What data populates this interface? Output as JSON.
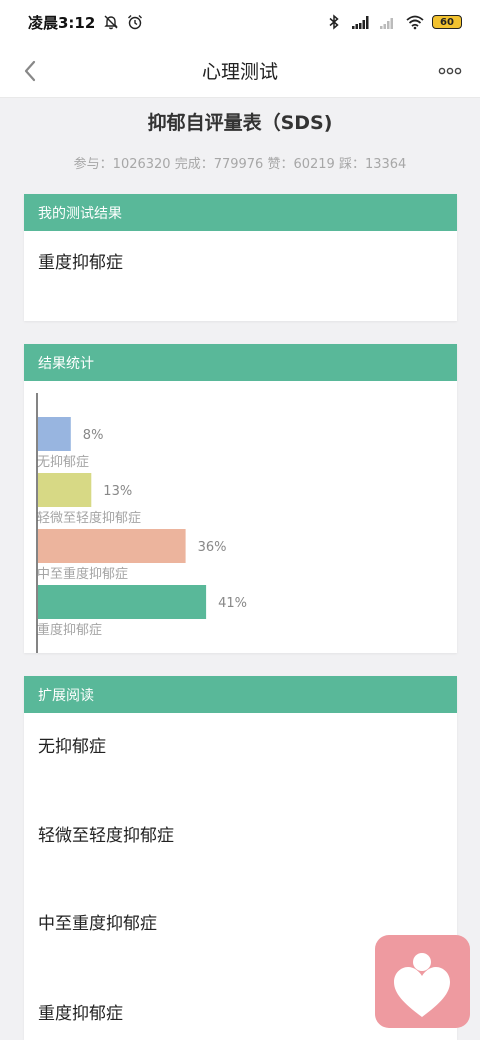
{
  "status_bar": {
    "time": "凌晨3:12",
    "battery": "60",
    "icons": [
      "mute-bell-icon",
      "alarm-icon",
      "bluetooth-icon",
      "hd-signal-icon",
      "signal-icon",
      "wifi-icon",
      "battery-icon"
    ]
  },
  "nav": {
    "title": "心理测试",
    "back_icon": "chevron-left-icon",
    "more_icon": "more-icon"
  },
  "test": {
    "title": "抑郁自评量表（SDS)",
    "stats": "参与：1026320 完成：779976 赞：60219 踩：13364"
  },
  "result_card": {
    "header": "我的测试结果",
    "text": "重度抑郁症"
  },
  "stats_card": {
    "header": "结果统计"
  },
  "chart_data": {
    "type": "bar",
    "orientation": "horizontal",
    "categories": [
      "无抑郁症",
      "轻微至轻度抑郁症",
      "中至重度抑郁症",
      "重度抑郁症"
    ],
    "values": [
      8,
      13,
      36,
      41
    ],
    "value_labels": [
      "8%",
      "13%",
      "36%",
      "41%"
    ],
    "colors": [
      "#98b5e0",
      "#d7d985",
      "#ecb49d",
      "#59b899"
    ],
    "unit": "%",
    "xlim": [
      0,
      100
    ],
    "grid": false,
    "legend": "none"
  },
  "reading_card": {
    "header": "扩展阅读",
    "items": [
      "无抑郁症",
      "轻微至轻度抑郁症",
      "中至重度抑郁症",
      "重度抑郁症"
    ]
  },
  "fab": {
    "icon": "heart-person-icon"
  }
}
